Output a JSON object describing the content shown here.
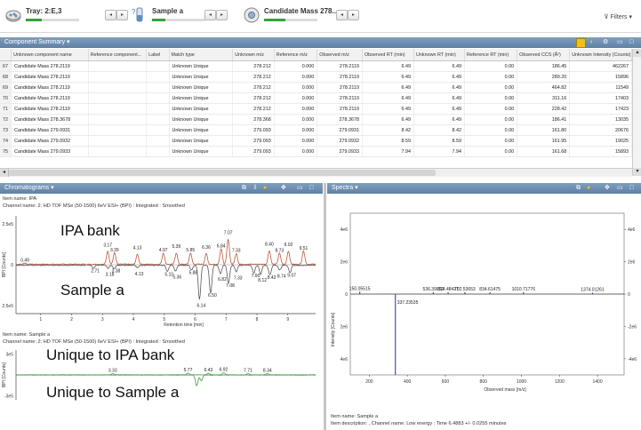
{
  "toolbar": {
    "tray_label": "Tray: 2:E,3",
    "sample_label": "Sample a",
    "candidate_label": "Candidate Mass 278....",
    "filters_label": "Filters"
  },
  "component_summary": {
    "title": "Component Summary",
    "columns": [
      "",
      "Unknown component name",
      "Reference component...",
      "Label",
      "Match type",
      "Unknown m/z",
      "Reference m/z",
      "Observed m/z",
      "Observed RT (min)",
      "Unknown RT (min)",
      "Reference RT (min)",
      "Observed CCS (Å²)",
      "Unknown Intensity (Counts)"
    ],
    "rows": [
      [
        "67",
        "Candidate Mass 278.2119",
        "",
        "",
        "Unknown Unique",
        "278.212",
        "0.000",
        "278.2119",
        "6.49",
        "6.49",
        "0.00",
        "186.45",
        "462267"
      ],
      [
        "68",
        "Candidate Mass 278.2119",
        "",
        "",
        "Unknown Unique",
        "278.212",
        "0.000",
        "278.2119",
        "6.49",
        "6.49",
        "0.00",
        "289.20",
        "15896"
      ],
      [
        "69",
        "Candidate Mass 278.2119",
        "",
        "",
        "Unknown Unique",
        "278.212",
        "0.000",
        "278.2119",
        "6.49",
        "6.49",
        "0.00",
        "464.82",
        "11549"
      ],
      [
        "70",
        "Candidate Mass 278.2119",
        "",
        "",
        "Unknown Unique",
        "278.212",
        "0.000",
        "278.2119",
        "6.49",
        "6.49",
        "0.00",
        "311.16",
        "17403"
      ],
      [
        "71",
        "Candidate Mass 278.2119",
        "",
        "",
        "Unknown Unique",
        "278.212",
        "0.000",
        "278.2119",
        "6.49",
        "6.49",
        "0.00",
        "228.42",
        "17423"
      ],
      [
        "72",
        "Candidate Mass 278.3678",
        "",
        "",
        "Unknown Unique",
        "278.368",
        "0.000",
        "278.3678",
        "6.49",
        "6.49",
        "0.00",
        "186.41",
        "13035"
      ],
      [
        "73",
        "Candidate Mass 279.0931",
        "",
        "",
        "Unknown Unique",
        "279.093",
        "0.000",
        "279.0931",
        "8.42",
        "8.42",
        "0.00",
        "161.80",
        "20676"
      ],
      [
        "74",
        "Candidate Mass 279.0932",
        "",
        "",
        "Unknown Unique",
        "279.093",
        "0.000",
        "279.0932",
        "8.59",
        "8.59",
        "0.00",
        "161.95",
        "19025"
      ],
      [
        "75",
        "Candidate Mass 279.0933",
        "",
        "",
        "Unknown Unique",
        "279.093",
        "0.000",
        "279.0933",
        "7.94",
        "7.94",
        "0.00",
        "161.68",
        "15893"
      ]
    ]
  },
  "chromatograms": {
    "title": "Chromatograms",
    "item1_name": "Item name: IPA",
    "item1_channel": "Channel name: 2: HD TOF MSe (50-1500) 6eV ESI+ (BPI) : Integrated : Smoothed",
    "item2_name": "Item name: Sample a",
    "item2_channel": "Channel name: 2: HD TOF MSe (50-1500) 6eV ESI+ (BPI) : Integrated : Smoothed",
    "overlay_top": "IPA bank",
    "overlay_bottom": "Sample a",
    "overlay_unique_top": "Unique to IPA bank",
    "overlay_unique_bottom": "Unique to Sample a",
    "y_label": "BPI [Counts]",
    "x_label": "Retention time [min]",
    "tick_2_5e5": "2.5e5",
    "tick_0": "0",
    "tick_neg_2_5e5": "2.5e5",
    "tick_3e5": "3e5",
    "tick_neg_3e5": "-3e5"
  },
  "spectra": {
    "title": "Spectra",
    "y_label": "Intensity [Counts]",
    "x_label": "Observed mass [m/z]",
    "item_name": "Item name: Sample a",
    "item_description": "Item description: , Channel name: Low energy : Time 6.4883 +/- 0.0255 minutes"
  },
  "colors": {
    "accent": "#5f80a4",
    "header_bar": "#6f8fb2",
    "sample_trace": "#b85a3a",
    "ipa_trace": "#5a5a5a",
    "unique_trace": "#40a040",
    "spectrum_stick": "#1f2fb0",
    "progress": "#3aa03a"
  },
  "chart_data": [
    {
      "type": "line",
      "title": "",
      "xlabel": "Retention time [min]",
      "ylabel": "BPI [Counts]",
      "xlim": [
        0.2,
        9.9
      ],
      "ylim": [
        -300000,
        300000
      ],
      "x_ticks": [
        1,
        2,
        3,
        4,
        5,
        6,
        7,
        8,
        9
      ],
      "series": [
        {
          "name": "IPA bank",
          "peaks": [
            {
              "x": 0.49,
              "y": 8000,
              "label": "0.49"
            },
            {
              "x": 3.17,
              "y": 80000,
              "label": "3.17"
            },
            {
              "x": 3.39,
              "y": 72000,
              "label": "3.39"
            },
            {
              "x": 4.13,
              "y": 62000,
              "label": "4.13"
            },
            {
              "x": 4.97,
              "y": 70000,
              "label": "4.97"
            },
            {
              "x": 5.39,
              "y": 70000,
              "label": "5.39"
            },
            {
              "x": 5.85,
              "y": 70000,
              "label": "5.85"
            },
            {
              "x": 6.36,
              "y": 65000,
              "label": "6.36"
            },
            {
              "x": 6.84,
              "y": 95000,
              "label": "6.84"
            },
            {
              "x": 7.07,
              "y": 155000,
              "label": "7.07"
            },
            {
              "x": 7.33,
              "y": 68000,
              "label": "7.33"
            },
            {
              "x": 8.4,
              "y": 85000,
              "label": "8.40"
            },
            {
              "x": 8.73,
              "y": 68000,
              "label": "8.73"
            },
            {
              "x": 9.02,
              "y": 82000,
              "label": "9.02"
            },
            {
              "x": 9.51,
              "y": 82000,
              "label": "9.51"
            }
          ]
        },
        {
          "name": "Sample a",
          "peaks": [
            {
              "x": 2.71,
              "y": -20000,
              "label": "2.71"
            },
            {
              "x": 3.18,
              "y": -20000,
              "label": "3.18"
            },
            {
              "x": 3.38,
              "y": -20000,
              "label": "3.38"
            },
            {
              "x": 4.13,
              "y": -15000,
              "label": "4.13"
            },
            {
              "x": 5.1,
              "y": -40000,
              "label": "5.10"
            },
            {
              "x": 5.36,
              "y": -35000,
              "label": "5.36"
            },
            {
              "x": 5.88,
              "y": -30000,
              "label": "5.88"
            },
            {
              "x": 6.14,
              "y": -210000,
              "label": "6.14"
            },
            {
              "x": 6.5,
              "y": -170000,
              "label": "6.50"
            },
            {
              "x": 6.82,
              "y": -50000,
              "label": "6.82"
            },
            {
              "x": 7.08,
              "y": -110000,
              "label": "7.08"
            },
            {
              "x": 7.33,
              "y": -40000,
              "label": "7.33"
            },
            {
              "x": 7.9,
              "y": -50000,
              "label": "7.90"
            },
            {
              "x": 8.12,
              "y": -55000,
              "label": "8.12"
            },
            {
              "x": 8.42,
              "y": -60000,
              "label": "8.42"
            },
            {
              "x": 8.74,
              "y": -30000,
              "label": "8.74"
            },
            {
              "x": 9.07,
              "y": -45000,
              "label": "9.07"
            }
          ]
        }
      ]
    },
    {
      "type": "line",
      "title": "",
      "xlabel": "",
      "ylabel": "BPI [Counts]",
      "xlim": [
        0.2,
        9.9
      ],
      "ylim": [
        -300000,
        300000
      ],
      "series": [
        {
          "name": "Unique to IPA bank",
          "peaks": [
            {
              "x": 3.33,
              "y": 15000,
              "label": "3.33"
            },
            {
              "x": 5.77,
              "y": 20000,
              "label": "5.77"
            },
            {
              "x": 6.43,
              "y": 20000,
              "label": "6.43"
            },
            {
              "x": 6.92,
              "y": 25000,
              "label": "6.92"
            },
            {
              "x": 7.71,
              "y": 15000,
              "label": "7.71"
            },
            {
              "x": 8.34,
              "y": 15000,
              "label": "8.34"
            }
          ]
        },
        {
          "name": "Unique to Sample a",
          "peaks": [
            {
              "x": 6.05,
              "y": -130000,
              "label": ""
            },
            {
              "x": 6.2,
              "y": -70000,
              "label": ""
            }
          ]
        }
      ]
    },
    {
      "type": "bar",
      "title": "",
      "xlabel": "Observed mass [m/z]",
      "ylabel": "Intensity [Counts]",
      "xlim": [
        100,
        1540
      ],
      "ylim": [
        -500000,
        500000
      ],
      "x_ticks": [
        200,
        400,
        600,
        800,
        1000,
        1200,
        1400
      ],
      "y_ticks": [
        "4e6",
        "2e6",
        "0",
        "2e6",
        "4e6"
      ],
      "right_ticks": [
        "4e6",
        "2e6",
        "0",
        "-2e6",
        "-4e6"
      ],
      "peaks": [
        {
          "x": 150.05515,
          "y": 15000,
          "label": "150.05515"
        },
        {
          "x": 337.23535,
          "y": -500000,
          "label": "337.23535"
        },
        {
          "x": 536.39052,
          "y": 12000,
          "label": "536.39052"
        },
        {
          "x": 614.48427,
          "y": 12000,
          "label": "614.48427"
        },
        {
          "x": 702.53653,
          "y": 12000,
          "label": "702.53653"
        },
        {
          "x": 834.61475,
          "y": 12000,
          "label": "834.61475"
        },
        {
          "x": 1010.71776,
          "y": 12000,
          "label": "1010.71776"
        },
        {
          "x": 1374.01261,
          "y": 8000,
          "label": "1374.01261"
        }
      ]
    }
  ]
}
